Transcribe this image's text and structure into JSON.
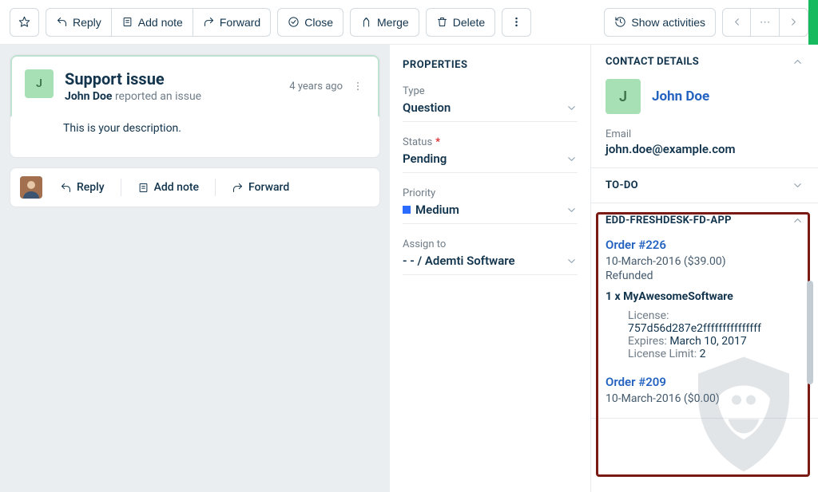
{
  "toolbar": {
    "reply": "Reply",
    "add_note": "Add note",
    "forward": "Forward",
    "close": "Close",
    "merge": "Merge",
    "delete": "Delete",
    "show_activities": "Show activities"
  },
  "conversation": {
    "initial": "J",
    "title": "Support issue",
    "author": "John Doe",
    "action": "reported an issue",
    "age": "4 years ago",
    "body": "This is your description."
  },
  "reply_bar": {
    "reply": "Reply",
    "add_note": "Add note",
    "forward": "Forward"
  },
  "properties": {
    "section": "PROPERTIES",
    "type_label": "Type",
    "type_value": "Question",
    "status_label": "Status",
    "status_value": "Pending",
    "priority_label": "Priority",
    "priority_value": "Medium",
    "assign_label": "Assign to",
    "assign_value": "- - / Ademti Software"
  },
  "contact": {
    "section": "CONTACT DETAILS",
    "initial": "J",
    "name": "John Doe",
    "email_label": "Email",
    "email_value": "john.doe@example.com"
  },
  "todo": {
    "section": "TO-DO"
  },
  "app": {
    "section": "EDD-FRESHDESK-FD-APP",
    "orders": [
      {
        "link": "Order #226",
        "date_price": "10-March-2016 ($39.00)",
        "status": "Refunded",
        "line_item": "1 x MyAwesomeSoftware",
        "license_label": "License:",
        "license_key": "757d56d287e2fffffffffffffff",
        "expires_label": "Expires:",
        "expires_value": "March 10, 2017",
        "limit_label": "License Limit:",
        "limit_value": "2"
      },
      {
        "link": "Order #209",
        "date_price": "10-March-2016 ($0.00)"
      }
    ]
  }
}
